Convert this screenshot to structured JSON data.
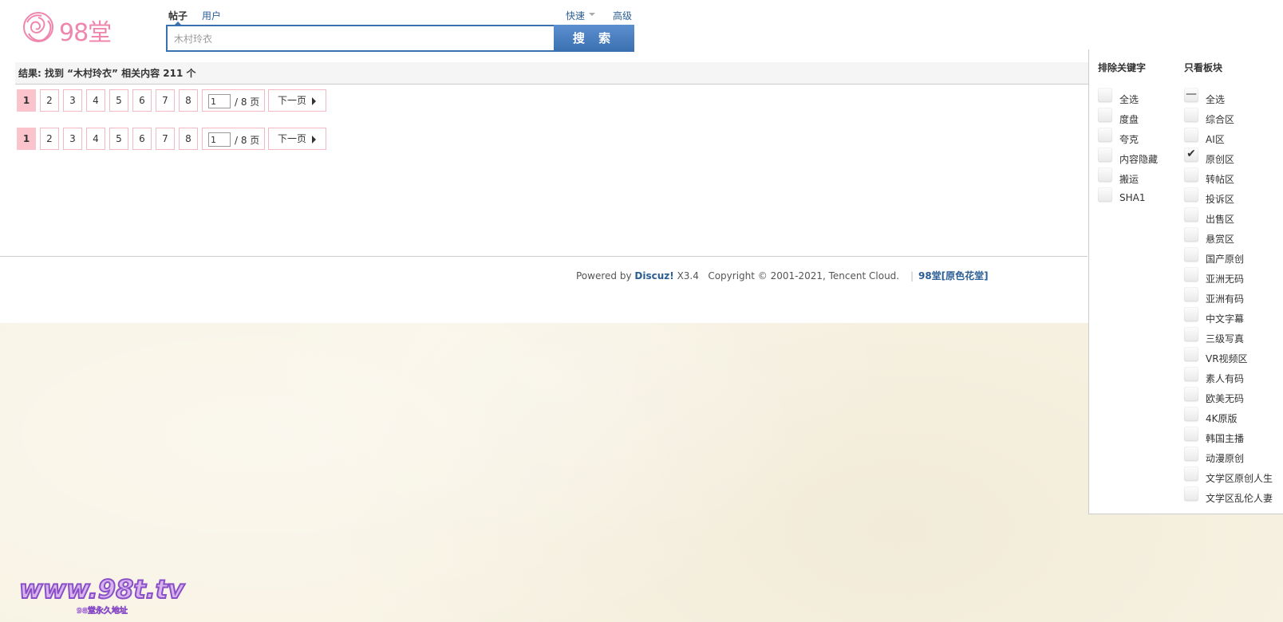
{
  "header": {
    "brand": "98堂",
    "tabs": [
      "帖子",
      "用户"
    ],
    "quick_label": "快速",
    "advanced_label": "高级"
  },
  "search": {
    "value": "木村玲衣",
    "button_label": "搜 索"
  },
  "results": {
    "summary": "结果: 找到 “木村玲衣” 相关内容 211 个"
  },
  "pagination": {
    "pages": [
      "1",
      "2",
      "3",
      "4",
      "5",
      "6",
      "7",
      "8"
    ],
    "current": "1",
    "input_value": "1",
    "total_label": "/ 8 页",
    "next_label": "下一页"
  },
  "footer": {
    "powered_prefix": "Powered by",
    "product": "Discuz!",
    "version": "X3.4",
    "copyright": "Copyright © 2001-2021, Tencent Cloud.",
    "site_link": "98堂[原色花堂]"
  },
  "filter_panel": {
    "exclude_title": "排除关键字",
    "exclude_items": [
      "全选",
      "度盘",
      "夸克",
      "内容隐藏",
      "搬运",
      "SHA1"
    ],
    "only_title": "只看板块",
    "only_items": [
      "全选",
      "综合区",
      "AI区",
      "原创区",
      "转帖区",
      "投诉区",
      "出售区",
      "悬赏区",
      "国产原创",
      "亚洲无码",
      "亚洲有码",
      "中文字幕",
      "三级写真",
      "VR视频区",
      "素人有码",
      "欧美无码",
      "4K原版",
      "韩国主播",
      "动漫原创",
      "文学区原创人生",
      "文学区乱伦人妻"
    ],
    "only_states": [
      "partial",
      "",
      "",
      "checked",
      "",
      "",
      "",
      "",
      "",
      "",
      "",
      "",
      "",
      "",
      "",
      "",
      "",
      "",
      "",
      "",
      ""
    ]
  },
  "watermark": {
    "url": "www.98t.tv",
    "sub": "98堂永久地址"
  },
  "colors": {
    "accent_blue": "#3a6fb0",
    "link_blue": "#2b5e95",
    "pager_border": "#f2b9c5",
    "pager_current": "#fbc3cb",
    "logo_pink": "#ef86ad"
  }
}
